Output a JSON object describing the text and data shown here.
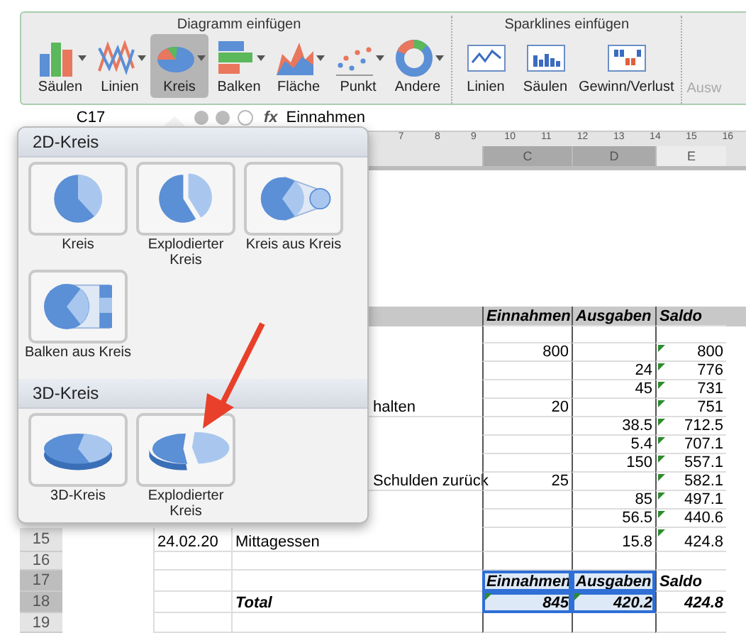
{
  "ribbon": {
    "groups": [
      {
        "title": "Diagramm einfügen",
        "buttons": [
          {
            "label": "Säulen",
            "kind": "column",
            "selected": false,
            "menu": true
          },
          {
            "label": "Linien",
            "kind": "line",
            "selected": false,
            "menu": true
          },
          {
            "label": "Kreis",
            "kind": "pie",
            "selected": true,
            "menu": true
          },
          {
            "label": "Balken",
            "kind": "bar",
            "selected": false,
            "menu": true
          },
          {
            "label": "Fläche",
            "kind": "area",
            "selected": false,
            "menu": true
          },
          {
            "label": "Punkt",
            "kind": "scatter",
            "selected": false,
            "menu": true
          },
          {
            "label": "Andere",
            "kind": "donut",
            "selected": false,
            "menu": true
          }
        ]
      },
      {
        "title": "Sparklines einfügen",
        "buttons": [
          {
            "label": "Linien",
            "kind": "spark_line",
            "selected": false,
            "menu": false
          },
          {
            "label": "Säulen",
            "kind": "spark_column",
            "selected": false,
            "menu": false
          },
          {
            "label": "Gewinn/Verlust",
            "kind": "spark_winloss",
            "selected": false,
            "menu": false
          }
        ]
      }
    ],
    "cut_button": {
      "label": "Ausw",
      "disabled": true
    }
  },
  "formula_bar": {
    "name_box": "C17",
    "fx": "fx",
    "content": "Einnahmen"
  },
  "ruler": [
    "7",
    "8",
    "9",
    "10",
    "11",
    "12",
    "13",
    "14",
    "15",
    "16"
  ],
  "columns": [
    {
      "label": "C",
      "selected": true
    },
    {
      "label": "D",
      "selected": true
    },
    {
      "label": "E",
      "selected": false
    }
  ],
  "sheet": {
    "header": {
      "income": "Einnahmen",
      "expense": "Ausgaben",
      "balance": "Saldo"
    },
    "rows": [
      {
        "income": "800",
        "expense": "",
        "balance": "800",
        "marker": true
      },
      {
        "income": "",
        "expense": "24",
        "balance": "776",
        "marker": true
      },
      {
        "income": "",
        "expense": "45",
        "balance": "731",
        "marker": true
      },
      {
        "what": "halten",
        "cut": true,
        "income": "20",
        "expense": "",
        "balance": "751",
        "marker": true
      },
      {
        "income": "",
        "expense": "38.5",
        "balance": "712.5",
        "marker": true
      },
      {
        "income": "",
        "expense": "5.4",
        "balance": "707.1",
        "marker": true
      },
      {
        "income": "",
        "expense": "150",
        "balance": "557.1",
        "marker": true
      },
      {
        "what": "Schulden zurück",
        "cut": true,
        "income": "25",
        "expense": "",
        "balance": "582.1",
        "marker": true
      },
      {
        "income": "",
        "expense": "85",
        "balance": "497.1",
        "marker": true
      },
      {
        "income": "",
        "expense": "56.5",
        "balance": "440.6",
        "marker": true
      },
      {
        "date": "24.02.20",
        "what": "Mittagessen",
        "cut": false,
        "income": "",
        "expense": "15.8",
        "balance": "424.8",
        "marker": true
      }
    ],
    "row_numbers": [
      {
        "label": "15",
        "selected": false
      },
      {
        "label": "16",
        "selected": false
      },
      {
        "label": "17",
        "selected": true
      },
      {
        "label": "18",
        "selected": true
      },
      {
        "label": "19",
        "selected": false
      }
    ],
    "summary_header": [
      {
        "text": "Einnahmen",
        "selected": true
      },
      {
        "text": "Ausgaben",
        "selected": true
      },
      {
        "text": "Saldo",
        "selected": false
      }
    ],
    "total": {
      "label": "Total",
      "cells": [
        {
          "text": "845",
          "selected": true,
          "marker": true
        },
        {
          "text": "420.2",
          "selected": true,
          "marker": true
        },
        {
          "text": "424.8",
          "selected": false,
          "marker": false
        }
      ]
    }
  },
  "popup": {
    "sections": [
      {
        "title": "2D-Kreis",
        "items": [
          {
            "label": "Kreis",
            "kind": "pie"
          },
          {
            "label": "Explodierter Kreis",
            "kind": "exploded"
          },
          {
            "label": "Kreis aus Kreis",
            "kind": "pie_of_pie"
          },
          {
            "label": "Balken aus Kreis",
            "kind": "bar_of_pie"
          }
        ]
      },
      {
        "title": "3D-Kreis",
        "items": [
          {
            "label": "3D-Kreis",
            "kind": "pie3d"
          },
          {
            "label": "Explodierter Kreis",
            "kind": "exploded3d"
          }
        ]
      }
    ]
  }
}
